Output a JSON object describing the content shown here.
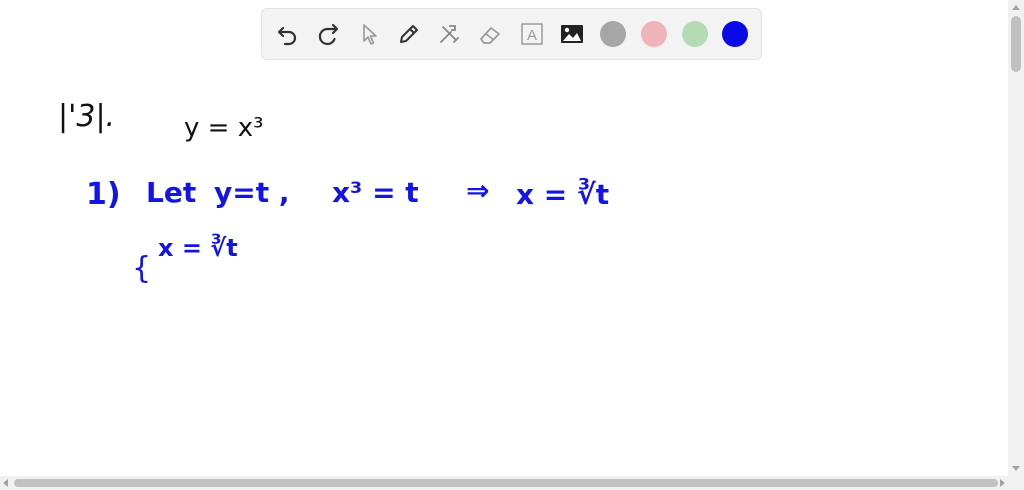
{
  "toolbar": {
    "tools": [
      {
        "name": "undo-icon",
        "label": "Undo"
      },
      {
        "name": "redo-icon",
        "label": "Redo"
      },
      {
        "name": "select-pointer-icon",
        "label": "Select"
      },
      {
        "name": "pen-icon",
        "label": "Pen"
      },
      {
        "name": "tools-icon",
        "label": "Tools"
      },
      {
        "name": "eraser-icon",
        "label": "Eraser"
      },
      {
        "name": "text-box-icon",
        "label": "Text"
      },
      {
        "name": "image-icon",
        "label": "Image"
      }
    ],
    "text_tool_glyph": "A",
    "colors": [
      "#a6a6a6",
      "#efb4b9",
      "#b4dbb4",
      "#0a0ae8"
    ],
    "selected_color": "#0a0ae8"
  },
  "canvas": {
    "problem_number": "|'3|.",
    "equation": "y = x³",
    "step1": {
      "index": "1)",
      "let_word": "Let",
      "let_expr": "y=t ,",
      "x_cubed": "x³ = t",
      "implies": "⇒",
      "result": "x = ∛t"
    },
    "system": {
      "brace": "{",
      "line1": "x = ∛t"
    }
  }
}
